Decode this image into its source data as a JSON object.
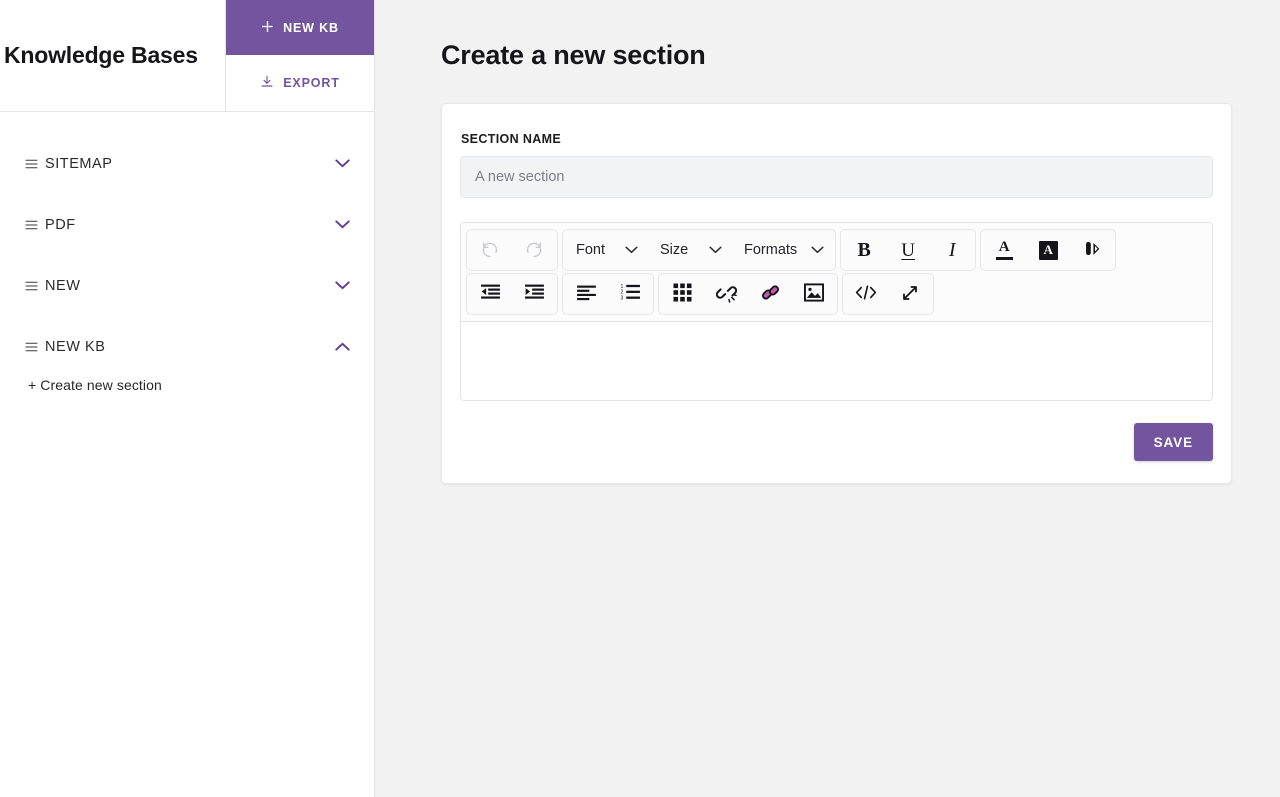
{
  "colors": {
    "accent_purple": "#73549F",
    "chevron_purple": "#5F3D96",
    "link_icon_pink": "#C456B0",
    "page_background": "#F2F2F2",
    "sidebar_background": "#FFFFFF",
    "card_background": "#FFFFFF",
    "input_background": "#F2F3F5",
    "toolbar_background": "#FCFCFC"
  },
  "sidebar": {
    "title": "Knowledge Bases",
    "actions": {
      "new_kb_label": "NEW KB",
      "new_kb_icon": "plus-icon",
      "export_label": "EXPORT",
      "export_icon": "download-icon"
    },
    "items": [
      {
        "label": "SITEMAP",
        "grip_icon": "drag-handle-icon",
        "chevron_icon": "chevron-down-icon",
        "expanded": false
      },
      {
        "label": "PDF",
        "grip_icon": "drag-handle-icon",
        "chevron_icon": "chevron-down-icon",
        "expanded": false
      },
      {
        "label": "NEW",
        "grip_icon": "drag-handle-icon",
        "chevron_icon": "chevron-down-icon",
        "expanded": false
      },
      {
        "label": "NEW KB",
        "grip_icon": "drag-handle-icon",
        "chevron_icon": "chevron-up-icon",
        "expanded": true
      }
    ],
    "sub_items": [
      {
        "label": "+ Create new section"
      }
    ]
  },
  "main": {
    "page_title": "Create a new section",
    "form": {
      "section_name_label": "SECTION NAME",
      "section_name_value": "",
      "section_name_placeholder": "A new section"
    },
    "editor": {
      "toolbar_row1": [
        {
          "group": "history",
          "buttons": [
            {
              "name": "undo-button",
              "icon": "undo-icon",
              "label": "",
              "disabled": true
            },
            {
              "name": "redo-button",
              "icon": "redo-icon",
              "label": "",
              "disabled": true
            }
          ]
        },
        {
          "group": "typography",
          "selects": [
            {
              "name": "font-select",
              "label": "Font",
              "icon": "chevron-down-icon"
            },
            {
              "name": "size-select",
              "label": "Size",
              "icon": "chevron-down-icon"
            },
            {
              "name": "formats-select",
              "label": "Formats",
              "icon": "chevron-down-icon"
            }
          ]
        },
        {
          "group": "style",
          "buttons": [
            {
              "name": "bold-button",
              "icon": "bold-icon",
              "label": "B",
              "disabled": false
            },
            {
              "name": "underline-button",
              "icon": "underline-icon",
              "label": "U",
              "disabled": false
            },
            {
              "name": "italic-button",
              "icon": "italic-icon",
              "label": "I",
              "disabled": false
            }
          ]
        },
        {
          "group": "color",
          "buttons": [
            {
              "name": "text-color-button",
              "icon": "text-color-icon",
              "label": "A",
              "disabled": false
            },
            {
              "name": "background-color-button",
              "icon": "background-color-icon",
              "label": "A",
              "disabled": false
            },
            {
              "name": "color-picker-button",
              "icon": "color-palette-icon",
              "label": "",
              "disabled": false
            }
          ]
        }
      ],
      "toolbar_row2": [
        {
          "group": "indent",
          "buttons": [
            {
              "name": "outdent-button",
              "icon": "outdent-icon"
            },
            {
              "name": "indent-button",
              "icon": "indent-icon"
            }
          ]
        },
        {
          "group": "align-list",
          "buttons": [
            {
              "name": "align-left-button",
              "icon": "align-left-icon"
            },
            {
              "name": "numbered-list-button",
              "icon": "numbered-list-icon"
            }
          ]
        },
        {
          "group": "insert",
          "buttons": [
            {
              "name": "insert-table-button",
              "icon": "table-grid-icon"
            },
            {
              "name": "unlink-button",
              "icon": "unlink-icon"
            },
            {
              "name": "insert-link-button",
              "icon": "link-icon"
            },
            {
              "name": "insert-image-button",
              "icon": "image-icon"
            }
          ]
        },
        {
          "group": "view",
          "buttons": [
            {
              "name": "source-code-button",
              "icon": "code-icon"
            },
            {
              "name": "fullscreen-button",
              "icon": "expand-arrows-icon"
            }
          ]
        }
      ],
      "content": ""
    },
    "save_label": "SAVE"
  }
}
